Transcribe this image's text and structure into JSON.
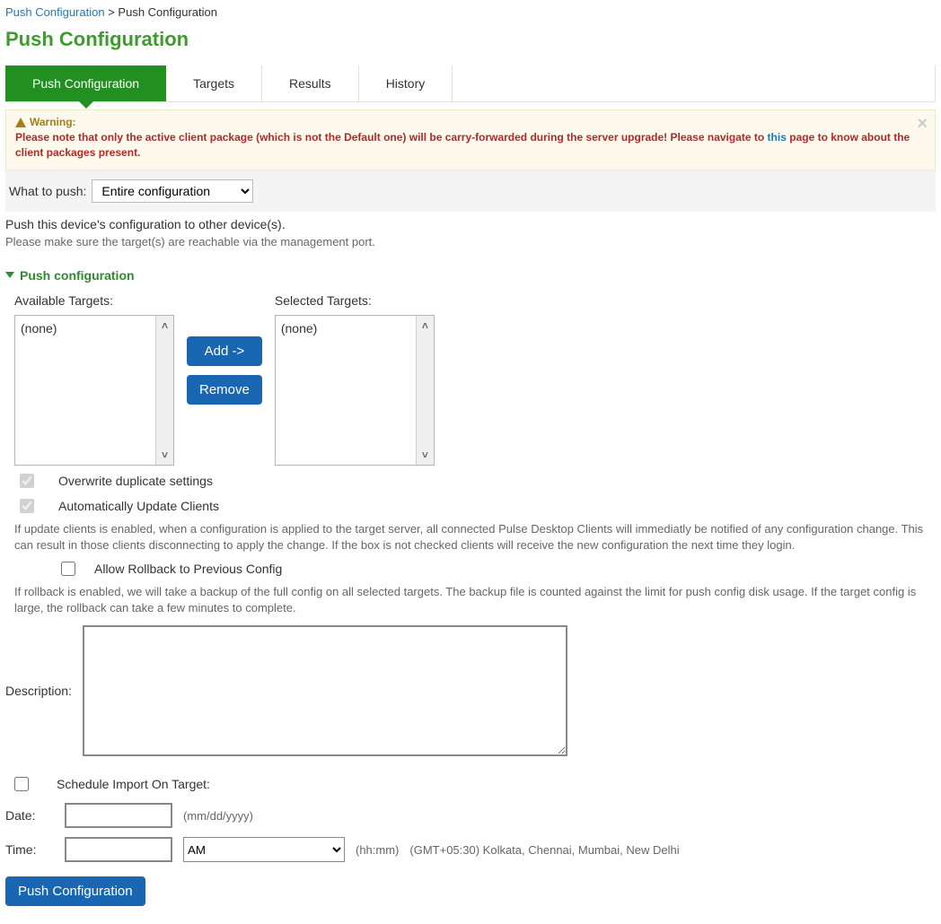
{
  "breadcrumb": {
    "root": "Push Configuration",
    "sep": ">",
    "current": "Push Configuration"
  },
  "page_title": "Push Configuration",
  "tabs": [
    "Push Configuration",
    "Targets",
    "Results",
    "History"
  ],
  "warning": {
    "label": "Warning:",
    "pre": "Please note that only the active client package (which is not the Default one) will be carry-forwarded during the server upgrade! Please navigate to ",
    "link": "this",
    "post": " page to know about the client packages present."
  },
  "what_to_push": {
    "label": "What to push:",
    "selected": "Entire configuration"
  },
  "push_line": "Push this device's configuration to other device(s).",
  "reach_line": "Please make sure the target(s) are reachable via the management port.",
  "section_title": "Push configuration",
  "targets": {
    "available_label": "Available Targets:",
    "available_none": "(none)",
    "selected_label": "Selected Targets:",
    "selected_none": "(none)",
    "add_btn": "Add ->",
    "remove_btn": "Remove"
  },
  "overwrite_label": "Overwrite duplicate settings",
  "auto_update_label": "Automatically Update Clients",
  "auto_update_help": "If update clients is enabled, when a configuration is applied to the target server, all connected Pulse Desktop Clients will immediatly be notified of any configuration change. This can result in those clients disconnecting to apply the change. If the box is not checked clients will receive the new configuration the next time they login.",
  "rollback_label": "Allow Rollback to Previous Config",
  "rollback_help": "If rollback is enabled, we will take a backup of the full config on all selected targets. The backup file is counted against the limit for push config disk usage. If the target config is large, the rollback can take a few minutes to complete.",
  "description_label": "Description:",
  "schedule_label": "Schedule Import On Target:",
  "date": {
    "label": "Date:",
    "hint": "(mm/dd/yyyy)"
  },
  "time": {
    "label": "Time:",
    "ampm": "AM",
    "hint": "(hh:mm)",
    "tz": "(GMT+05:30) Kolkata, Chennai, Mumbai, New Delhi"
  },
  "submit": "Push Configuration"
}
